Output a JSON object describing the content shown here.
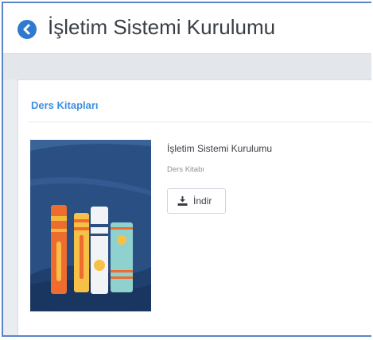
{
  "header": {
    "title": "İşletim Sistemi Kurulumu",
    "back_icon": "chevron-left-circle-icon",
    "accent": "#2f7ad0"
  },
  "section": {
    "title": "Ders Kitapları",
    "title_color": "#3e8ee0"
  },
  "book": {
    "name": "İşletim Sistemi Kurulumu",
    "type": "Ders Kitabı",
    "download_label": "İndir",
    "download_icon": "download-icon",
    "cover_icon": "books-illustration"
  }
}
